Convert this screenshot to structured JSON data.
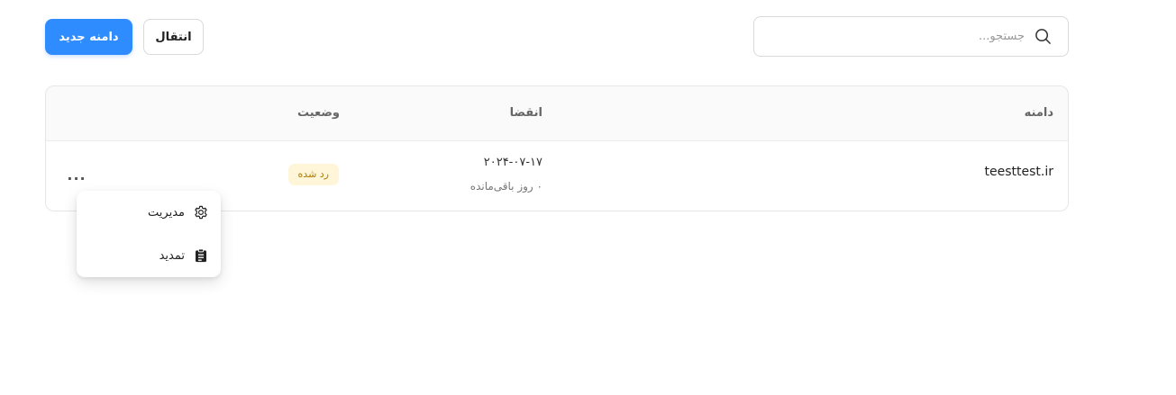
{
  "toolbar": {
    "new_domain_label": "دامنه جدید",
    "transfer_label": "انتقال",
    "search_placeholder": "جستجو...",
    "search_icon": "search-icon"
  },
  "table": {
    "headers": {
      "domain": "دامنه",
      "expiry": "انقضا",
      "status": "وضعیت"
    },
    "rows": [
      {
        "domain": "teesttest.ir",
        "expiry_date": "۲۰۲۴-۰۷-۱۷",
        "days_left": "۰ روز باقی‌مانده",
        "status": "رد شده",
        "status_color": "#fff6d9",
        "more_label": "..."
      }
    ]
  },
  "row_menu": {
    "items": [
      {
        "label": "مدیریت",
        "icon": "gear-icon"
      },
      {
        "label": "تمدید",
        "icon": "clipboard-icon"
      }
    ]
  },
  "colors": {
    "accent": "#2f8cff",
    "badge_bg": "#fff6d9",
    "badge_text": "#b07a00"
  }
}
